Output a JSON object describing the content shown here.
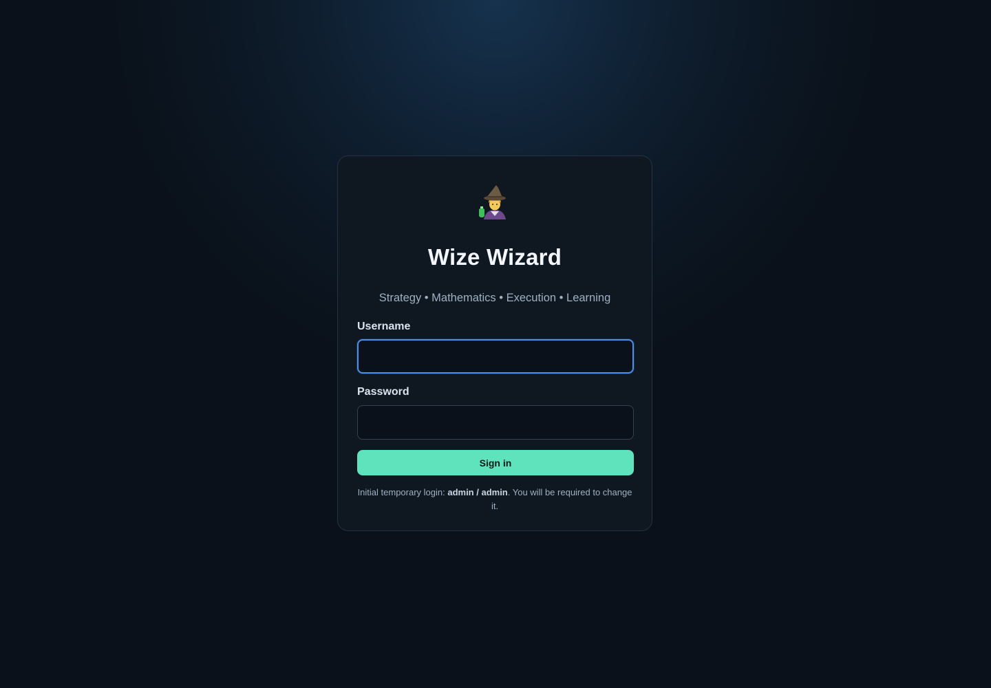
{
  "login": {
    "logo_icon": "wizard-icon",
    "title": "Wize Wizard",
    "tagline": "Strategy • Mathematics • Execution • Learning",
    "username_label": "Username",
    "username_value": "",
    "password_label": "Password",
    "password_value": "",
    "signin_label": "Sign in",
    "hint_prefix": "Initial temporary login: ",
    "hint_credentials": "admin / admin",
    "hint_suffix": ". You will be required to change it."
  },
  "colors": {
    "accent": "#5fe3bd",
    "focus_ring": "#4d8fe6",
    "card_bg": "#0f1821",
    "page_bg": "#0a111a"
  }
}
